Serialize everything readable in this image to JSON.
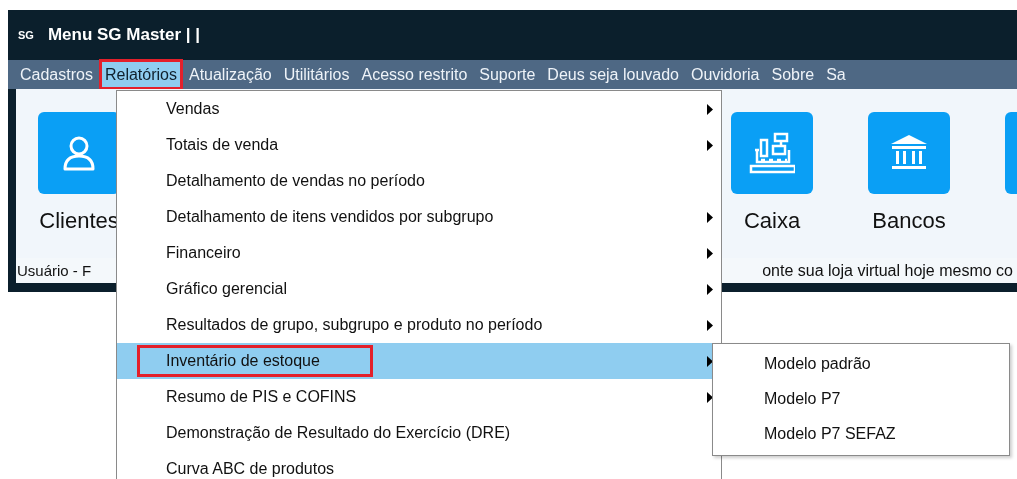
{
  "window": {
    "logo": "SG",
    "title": "Menu SG Master | |"
  },
  "menubar": [
    {
      "label": "Cadastros",
      "selected": false,
      "annotated": false
    },
    {
      "label": "Relatórios",
      "selected": true,
      "annotated": true
    },
    {
      "label": "Atualização",
      "selected": false,
      "annotated": false
    },
    {
      "label": "Utilitários",
      "selected": false,
      "annotated": false
    },
    {
      "label": "Acesso restrito",
      "selected": false,
      "annotated": false
    },
    {
      "label": "Suporte",
      "selected": false,
      "annotated": false
    },
    {
      "label": "Deus seja louvado",
      "selected": false,
      "annotated": false
    },
    {
      "label": "Ouvidoria",
      "selected": false,
      "annotated": false
    },
    {
      "label": "Sobre",
      "selected": false,
      "annotated": false
    },
    {
      "label": "Sa",
      "selected": false,
      "annotated": false
    }
  ],
  "tiles": [
    {
      "kind": "person",
      "label": "Clientes"
    },
    {
      "kind": "register",
      "label": "Caixa"
    },
    {
      "kind": "bank",
      "label": "Bancos"
    },
    {
      "kind": "blank"
    }
  ],
  "status_bar": {
    "left": "Usuário - F",
    "right": "onte sua loja virtual hoje mesmo co"
  },
  "dropdown": {
    "items": [
      {
        "label": "Vendas",
        "submenu": true,
        "selected": false,
        "annotated": false
      },
      {
        "label": "Totais de venda",
        "submenu": true,
        "selected": false,
        "annotated": false
      },
      {
        "label": "Detalhamento de vendas no período",
        "submenu": false,
        "selected": false,
        "annotated": false
      },
      {
        "label": "Detalhamento de itens vendidos por subgrupo",
        "submenu": true,
        "selected": false,
        "annotated": false
      },
      {
        "label": "Financeiro",
        "submenu": true,
        "selected": false,
        "annotated": false
      },
      {
        "label": "Gráfico gerencial",
        "submenu": true,
        "selected": false,
        "annotated": false
      },
      {
        "label": "Resultados de grupo, subgrupo e produto no período",
        "submenu": true,
        "selected": false,
        "annotated": false
      },
      {
        "label": "Inventário de estoque",
        "submenu": true,
        "selected": true,
        "annotated": true
      },
      {
        "label": "Resumo de PIS e COFINS",
        "submenu": true,
        "selected": false,
        "annotated": false
      },
      {
        "label": "Demonstração de Resultado do Exercício (DRE)",
        "submenu": false,
        "selected": false,
        "annotated": false
      },
      {
        "label": "Curva ABC de produtos",
        "submenu": false,
        "selected": false,
        "annotated": false
      }
    ]
  },
  "submenu": {
    "items": [
      {
        "label": "Modelo padrão"
      },
      {
        "label": "Modelo P7"
      },
      {
        "label": "Modelo P7 SEFAZ"
      }
    ]
  }
}
